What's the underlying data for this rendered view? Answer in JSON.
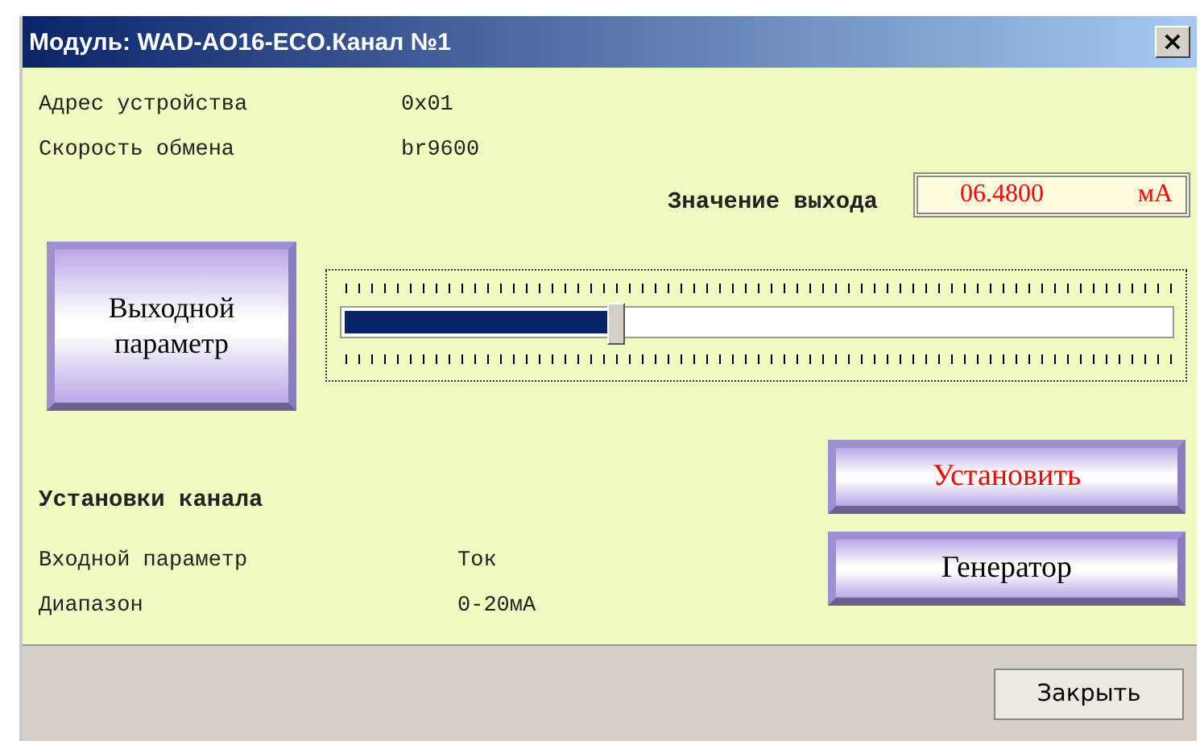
{
  "window": {
    "title": "Модуль: WAD-AO16-ECO.Канал №1",
    "close": "×"
  },
  "device_info": [
    {
      "label": "Адрес устройства",
      "value": "0x01"
    },
    {
      "label": "Скорость обмена",
      "value": "br9600"
    }
  ],
  "output": {
    "label": "Значение выхода",
    "value": "06.4800",
    "unit": "мА"
  },
  "output_parameter_button": "Выходной параметр",
  "slider": {
    "level": 0.33
  },
  "channel_settings": {
    "title": "Установки канала",
    "rows": [
      {
        "label": "Входной параметр",
        "value": "Ток"
      },
      {
        "label": "Диапазон",
        "value": "0-20мА"
      }
    ]
  },
  "action_buttons": [
    {
      "label": "Установить",
      "color": "#ff0000"
    },
    {
      "label": "Генератор",
      "color": "#000000"
    }
  ],
  "footer_button": "Закрыть"
}
